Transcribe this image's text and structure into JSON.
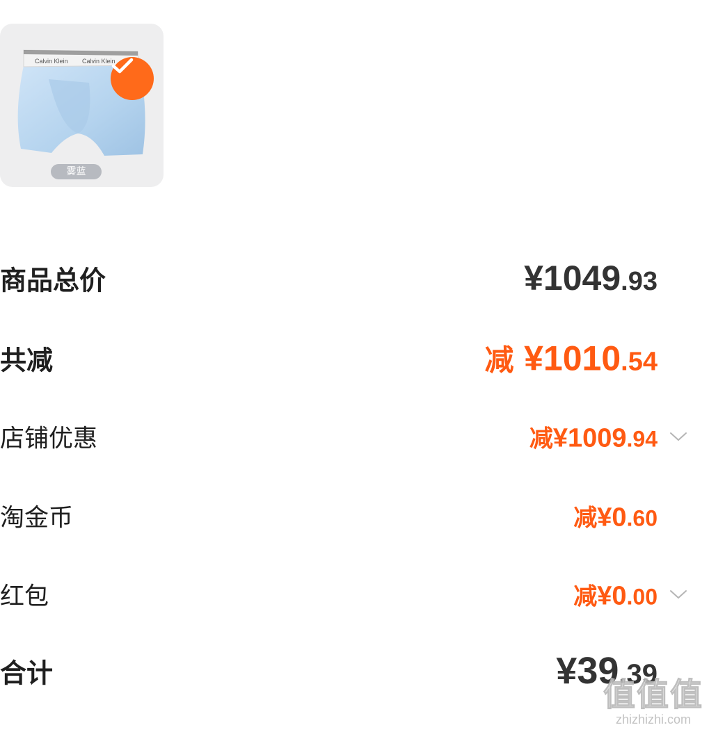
{
  "product": {
    "variant_tag": "雾蓝",
    "selected": true,
    "waistband_text": "Calvin Klein",
    "accent_color": "#ff6a1a"
  },
  "summary": {
    "total": {
      "label": "商品总价",
      "prefix": "",
      "main": "¥1049",
      "decimal": ".93"
    },
    "discount_total": {
      "label": "共减",
      "prefix": "减 ",
      "main": "¥1010",
      "decimal": ".54"
    },
    "store_discount": {
      "label": "店铺优惠",
      "prefix": "减",
      "main": "¥1009",
      "decimal": ".94",
      "expandable": true
    },
    "gold_coin": {
      "label": "淘金币",
      "prefix": "减",
      "main": "¥0",
      "decimal": ".60"
    },
    "red_packet": {
      "label": "红包",
      "prefix": "减",
      "main": "¥0",
      "decimal": ".00",
      "expandable": true
    },
    "final_total": {
      "label": "合计",
      "prefix": "",
      "main": "¥39",
      "decimal": ".39"
    }
  },
  "watermark": {
    "logo": "值值值",
    "url": "zhizhizhi.com"
  },
  "colors": {
    "orange": "#ff5a12",
    "dark_text": "#333333"
  }
}
